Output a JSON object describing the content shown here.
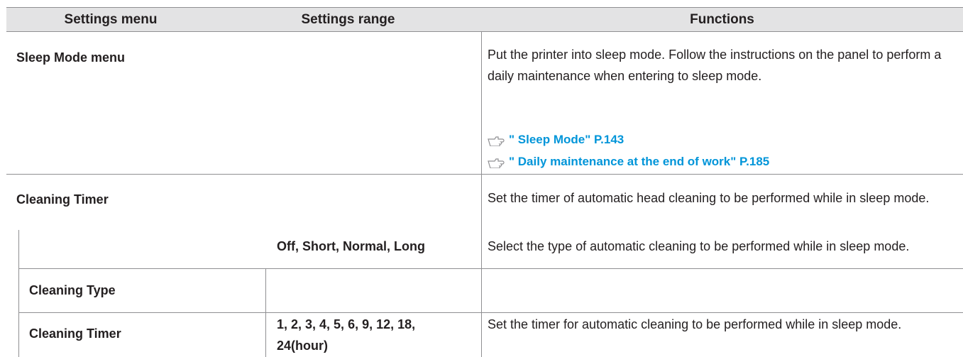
{
  "header": {
    "col1": "Settings menu",
    "col2": "Settings range",
    "col3": "Functions"
  },
  "rows": {
    "sleep_mode": {
      "menu": "Sleep Mode menu",
      "function": "Put the printer into sleep mode. Follow the instructions on the panel to perform a daily maintenance when entering to sleep mode.",
      "ref1": "\" Sleep Mode\" P.143",
      "ref2": "\" Daily maintenance at the end of work\" P.185",
      "ref_icon": "pointing-hand-icon"
    },
    "cleaning_timer_group": {
      "menu": "Cleaning Timer",
      "function": "Set the timer of automatic head cleaning to be performed while in sleep mode."
    },
    "cleaning_type": {
      "menu": "Cleaning Type",
      "range": "Off, Short, Normal, Long",
      "function": "Select the type of automatic cleaning to be performed while in sleep mode."
    },
    "cleaning_timer": {
      "menu": "Cleaning Timer",
      "range": "1, 2, 3, 4, 5, 6, 9, 12, 18, 24(hour)",
      "function": "Set the timer for automatic cleaning to be performed while in sleep mode."
    }
  },
  "colors": {
    "header_bg": "#e3e3e4",
    "rule": "#8f8f92",
    "link": "#0095d9",
    "text": "#231f20"
  }
}
